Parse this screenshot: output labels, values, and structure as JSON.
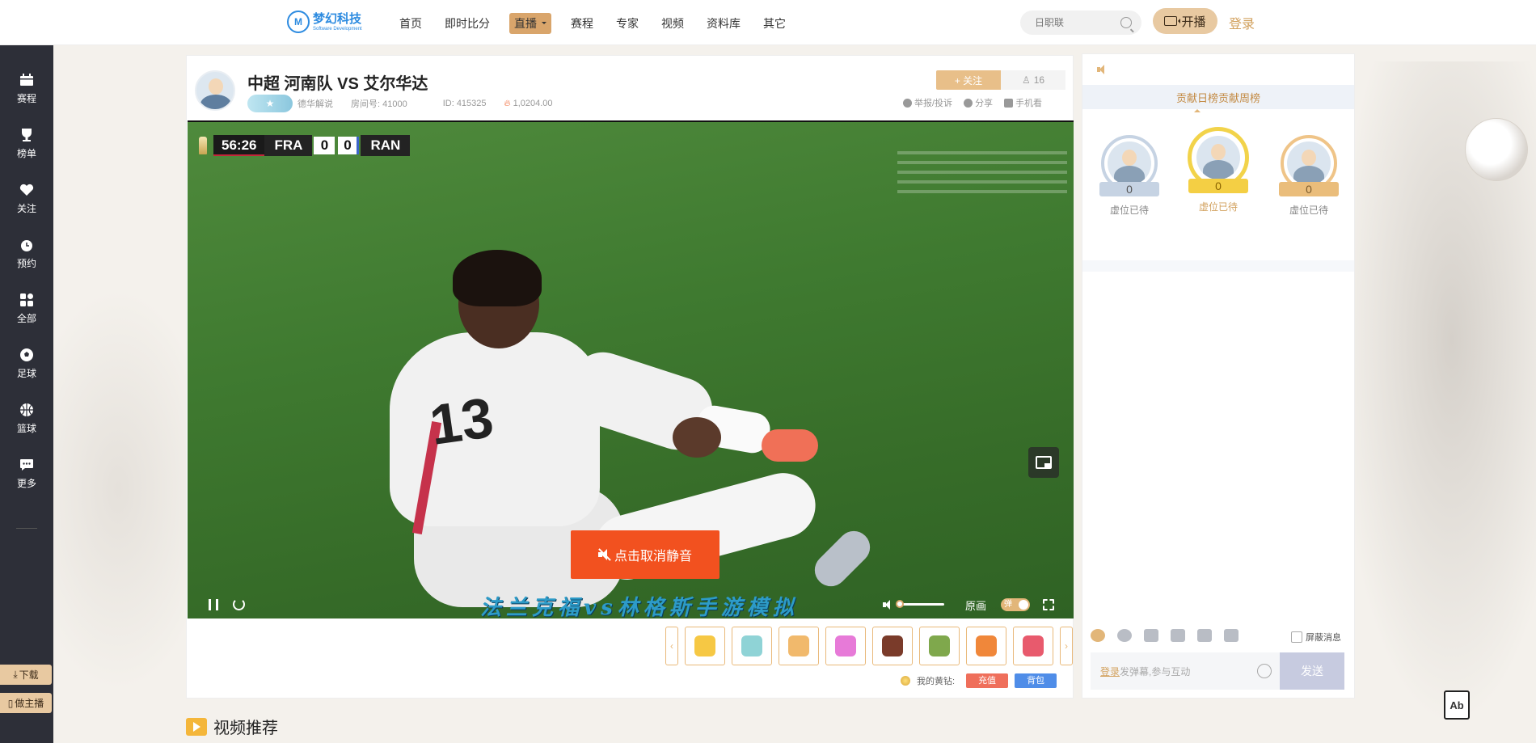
{
  "nav": {
    "logo_cn": "梦幻科技",
    "logo_en": "Software Development",
    "items": [
      "首页",
      "即时比分",
      "直播",
      "赛程",
      "专家",
      "视频",
      "资料库",
      "其它"
    ],
    "search_placeholder": "日职联",
    "broadcast": "开播",
    "login": "登录"
  },
  "sidebar": {
    "items": [
      {
        "label": "赛程",
        "icon": "calendar-icon"
      },
      {
        "label": "榜单",
        "icon": "trophy-icon"
      },
      {
        "label": "关注",
        "icon": "heart-icon"
      },
      {
        "label": "预约",
        "icon": "alarm-icon"
      },
      {
        "label": "全部",
        "icon": "grid-icon"
      },
      {
        "label": "足球",
        "icon": "football-icon"
      },
      {
        "label": "篮球",
        "icon": "basketball-icon"
      },
      {
        "label": "更多",
        "icon": "more-icon"
      }
    ],
    "download": "下载",
    "be_host": "做主播"
  },
  "room": {
    "title": "中超 河南队 VS 艾尔华达",
    "anchor": "德华解说",
    "room_no": "房间号: 41000",
    "id": "ID: 415325",
    "heat": "1,0204.00",
    "follow": "+ 关注",
    "fans": "16",
    "report": "举报/投诉",
    "share": "分享",
    "mobile": "手机看"
  },
  "video": {
    "clock": "56:26",
    "home": "FRA",
    "home_score": "0",
    "away_score": "0",
    "away": "RAN",
    "unmute": "点击取消静音",
    "caption": "法兰克福vs林格斯手游模拟",
    "quality": "原画",
    "danmu": "弹"
  },
  "gifts": [
    "star-gift",
    "ghost-gift",
    "trophy-gift",
    "ribbon-gift",
    "hat-gift",
    "plane-gift",
    "clown-gift",
    "rocket-gift"
  ],
  "wallet": {
    "label": "我的黄钻:",
    "recharge": "充值",
    "bag": "背包"
  },
  "recommend_title": "视频推荐",
  "rank": {
    "tab_day": "贡献日榜",
    "tab_week": "贡献周榜",
    "slots": [
      {
        "rank": "silver",
        "score": "0",
        "name": "虚位已待"
      },
      {
        "rank": "gold",
        "score": "0",
        "name": "虚位已待"
      },
      {
        "rank": "bronze",
        "score": "0",
        "name": "虚位已待"
      }
    ]
  },
  "chat": {
    "block": "屏蔽消息",
    "login": "登录",
    "placeholder": "发弹幕,参与互动",
    "send": "发送"
  },
  "float_button": "Ab"
}
